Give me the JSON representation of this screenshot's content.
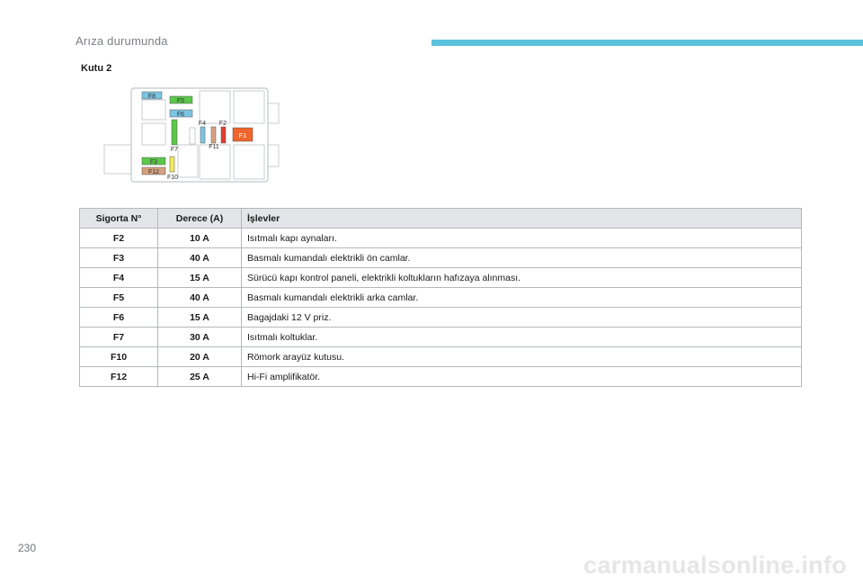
{
  "header": {
    "section_title": "Arıza durumunda",
    "accent_color": "#5bc2dd"
  },
  "box_title": "Kutu 2",
  "diagram": {
    "labels": {
      "F2": "F2",
      "F3": "F3",
      "F4": "F4",
      "F5": "F5",
      "F6": "F6",
      "F7": "F7",
      "F8": "F8",
      "F10": "F10",
      "F11": "F11",
      "F12": "F12",
      "F1": "F1"
    },
    "colors": {
      "blue": "#7cc4e4",
      "green": "#5bc84a",
      "yellow": "#f2ec5e",
      "tan": "#d6a17e",
      "red": "#e53b30",
      "orange": "#f0652a"
    }
  },
  "table": {
    "headers": {
      "fuse": "Sigorta N°",
      "rating": "Derece (A)",
      "functions": "İşlevler"
    },
    "rows": [
      {
        "fuse": "F2",
        "rating": "10 A",
        "function": "Isıtmalı kapı aynaları."
      },
      {
        "fuse": "F3",
        "rating": "40 A",
        "function": "Basmalı kumandalı elektrikli ön camlar."
      },
      {
        "fuse": "F4",
        "rating": "15 A",
        "function": "Sürücü kapı kontrol paneli, elektrikli koltukların hafızaya alınması."
      },
      {
        "fuse": "F5",
        "rating": "40 A",
        "function": "Basmalı kumandalı elektrikli arka camlar."
      },
      {
        "fuse": "F6",
        "rating": "15 A",
        "function": "Bagajdaki 12 V priz."
      },
      {
        "fuse": "F7",
        "rating": "30 A",
        "function": "Isıtmalı koltuklar."
      },
      {
        "fuse": "F10",
        "rating": "20 A",
        "function": "Römork arayüz kutusu."
      },
      {
        "fuse": "F12",
        "rating": "25 A",
        "function": "Hi-Fi amplifikatör."
      }
    ]
  },
  "footer": {
    "page_number": "230",
    "watermark": "carmanualsonline.info"
  }
}
